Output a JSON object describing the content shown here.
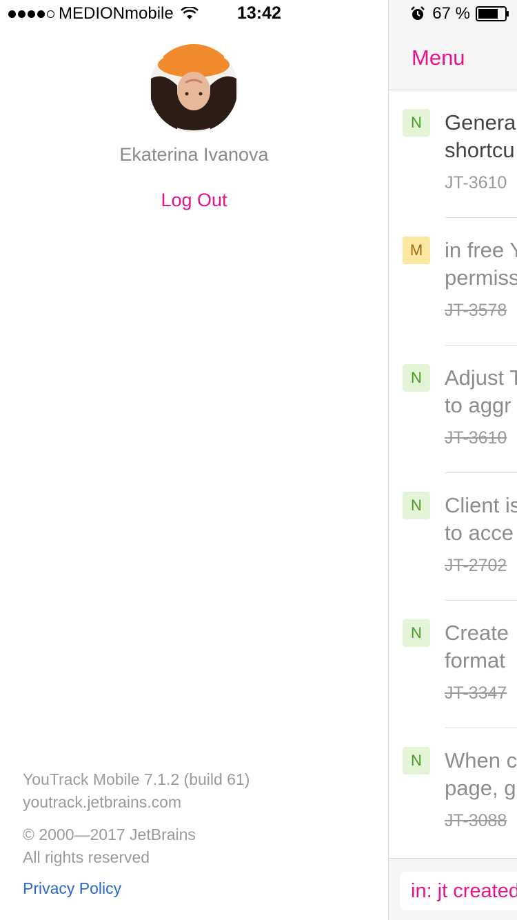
{
  "status_bar": {
    "carrier": "MEDIONmobile",
    "time": "13:42",
    "battery": "67 %"
  },
  "menu": {
    "user_name": "Ekaterina Ivanova",
    "logout_label": "Log Out",
    "footer": {
      "version": "YouTrack Mobile 7.1.2 (build 61)",
      "host": "youtrack.jetbrains.com",
      "copyright": "© 2000—2017 JetBrains",
      "rights": "All rights reserved",
      "privacy": "Privacy Policy"
    }
  },
  "list": {
    "menu_label": "Menu",
    "issues": [
      {
        "priority": "N",
        "line1": "Genera",
        "line2": "shortcu",
        "id": "JT-3610",
        "resolved": false
      },
      {
        "priority": "M",
        "line1": "in free Y",
        "line2": "permiss",
        "id": "JT-3578",
        "resolved": true
      },
      {
        "priority": "N",
        "line1": "Adjust T",
        "line2": "to aggr",
        "id": "JT-3610",
        "resolved": true
      },
      {
        "priority": "N",
        "line1": "Client is",
        "line2": "to acce",
        "id": "JT-2702",
        "resolved": true
      },
      {
        "priority": "N",
        "line1": "Create",
        "line2": "format",
        "id": "JT-3347",
        "resolved": true
      },
      {
        "priority": "N",
        "line1": "When c",
        "line2": "page, g",
        "id": "JT-3088",
        "resolved": true
      }
    ],
    "search_query": "in: jt created"
  }
}
